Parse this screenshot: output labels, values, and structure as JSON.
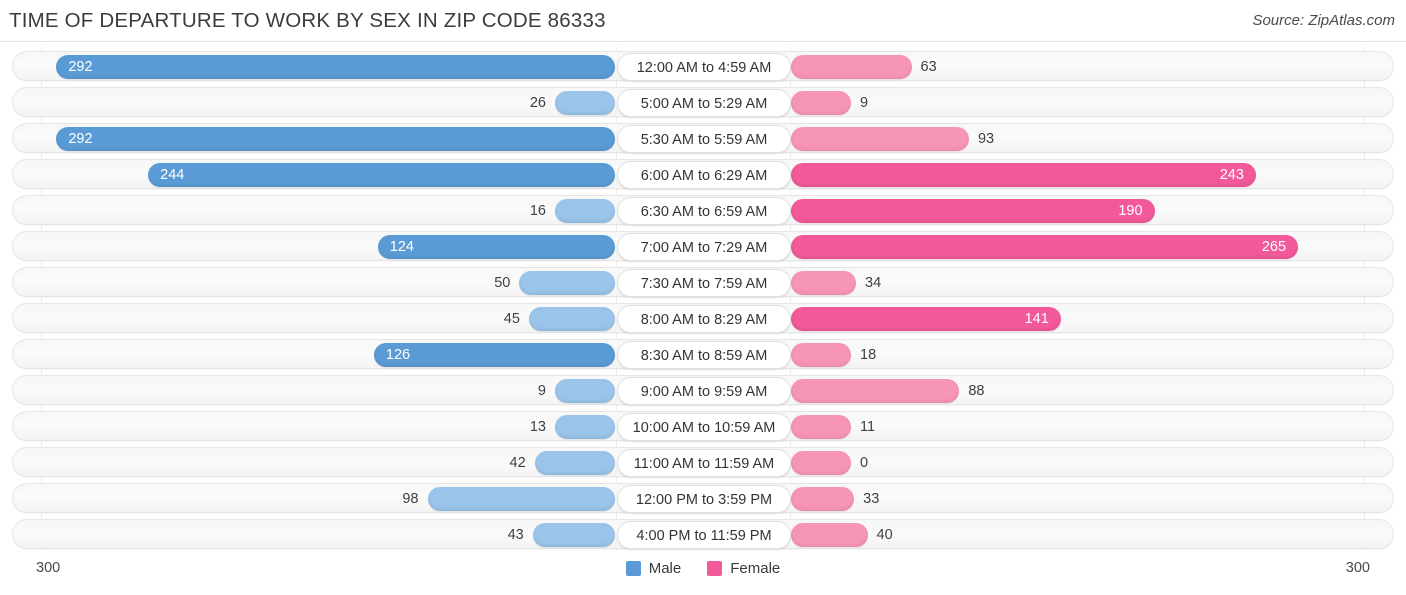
{
  "header": {
    "title": "TIME OF DEPARTURE TO WORK BY SEX IN ZIP CODE 86333",
    "source": "Source: ZipAtlas.com"
  },
  "axis": {
    "left_end": "300",
    "right_end": "300",
    "max": 300
  },
  "legend": {
    "items": [
      {
        "label": "Male",
        "color": "#5b9bd5"
      },
      {
        "label": "Female",
        "color": "#f2599a"
      }
    ]
  },
  "colors": {
    "male_strong": "#5b9bd5",
    "male_light": "#9ac4ea",
    "female_strong": "#f2599a",
    "female_light": "#f795b6",
    "track": "#f6f6f6",
    "text": "#3a3a3a"
  },
  "chart_data": {
    "type": "bar",
    "title": "TIME OF DEPARTURE TO WORK BY SEX IN ZIP CODE 86333",
    "subtitle": "",
    "xlabel": "",
    "ylabel": "",
    "orientation": "horizontal-diverging",
    "grid": true,
    "legend_position": "bottom-center",
    "xlim": [
      300,
      300
    ],
    "axis_max": 300,
    "categories": [
      "12:00 AM to 4:59 AM",
      "5:00 AM to 5:29 AM",
      "5:30 AM to 5:59 AM",
      "6:00 AM to 6:29 AM",
      "6:30 AM to 6:59 AM",
      "7:00 AM to 7:29 AM",
      "7:30 AM to 7:59 AM",
      "8:00 AM to 8:29 AM",
      "8:30 AM to 8:59 AM",
      "9:00 AM to 9:59 AM",
      "10:00 AM to 10:59 AM",
      "11:00 AM to 11:59 AM",
      "12:00 PM to 3:59 PM",
      "4:00 PM to 11:59 PM"
    ],
    "series": [
      {
        "name": "Male",
        "color": "#5b9bd5",
        "values": [
          292,
          26,
          292,
          244,
          16,
          124,
          50,
          45,
          126,
          9,
          13,
          42,
          98,
          43
        ]
      },
      {
        "name": "Female",
        "color": "#f2599a",
        "values": [
          63,
          9,
          93,
          243,
          190,
          265,
          34,
          141,
          18,
          88,
          11,
          0,
          33,
          40
        ]
      }
    ]
  },
  "rows": [
    {
      "category": "12:00 AM to 4:59 AM",
      "male": "292",
      "female": "63"
    },
    {
      "category": "5:00 AM to 5:29 AM",
      "male": "26",
      "female": "9"
    },
    {
      "category": "5:30 AM to 5:59 AM",
      "male": "292",
      "female": "93"
    },
    {
      "category": "6:00 AM to 6:29 AM",
      "male": "244",
      "female": "243"
    },
    {
      "category": "6:30 AM to 6:59 AM",
      "male": "16",
      "female": "190"
    },
    {
      "category": "7:00 AM to 7:29 AM",
      "male": "124",
      "female": "265"
    },
    {
      "category": "7:30 AM to 7:59 AM",
      "male": "50",
      "female": "34"
    },
    {
      "category": "8:00 AM to 8:29 AM",
      "male": "45",
      "female": "141"
    },
    {
      "category": "8:30 AM to 8:59 AM",
      "male": "126",
      "female": "18"
    },
    {
      "category": "9:00 AM to 9:59 AM",
      "male": "9",
      "female": "88"
    },
    {
      "category": "10:00 AM to 10:59 AM",
      "male": "13",
      "female": "11"
    },
    {
      "category": "11:00 AM to 11:59 AM",
      "male": "42",
      "female": "0"
    },
    {
      "category": "12:00 PM to 3:59 PM",
      "male": "98",
      "female": "33"
    },
    {
      "category": "4:00 PM to 11:59 PM",
      "male": "43",
      "female": "40"
    }
  ]
}
